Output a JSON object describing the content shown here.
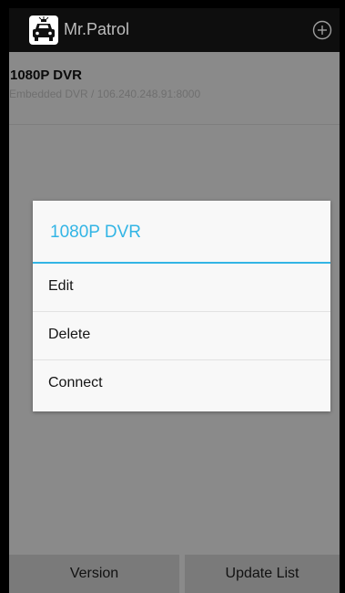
{
  "app": {
    "title": "Mr.Patrol",
    "icon": "police-car-icon",
    "add_icon": "add-circle-icon"
  },
  "device_list": [
    {
      "name": "1080P DVR",
      "description": "Embedded DVR / 106.240.248.91:8000"
    }
  ],
  "dialog": {
    "title": "1080P DVR",
    "items": [
      {
        "label": "Edit"
      },
      {
        "label": "Delete"
      },
      {
        "label": "Connect"
      }
    ]
  },
  "bottom_bar": {
    "version_label": "Version",
    "update_label": "Update List"
  },
  "colors": {
    "accent": "#33b5e5",
    "action_bar": "#0e0e0e",
    "dim_background": "#8a8a8a",
    "dialog_background": "#f8f8f8"
  }
}
